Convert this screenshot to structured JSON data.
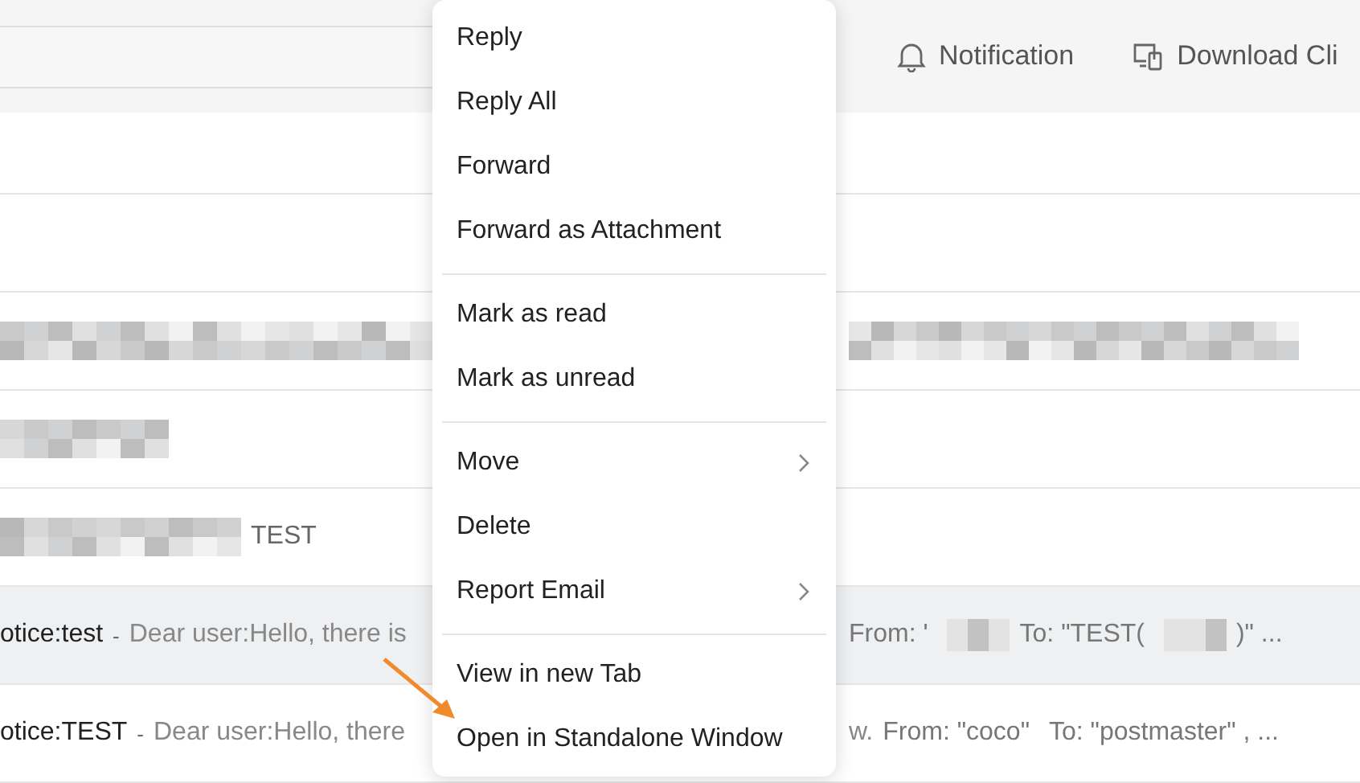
{
  "header": {
    "actions": [
      {
        "label": "Notification"
      },
      {
        "label": "Download Cli"
      }
    ]
  },
  "rows": [
    {
      "kind": "masked",
      "selected": false
    },
    {
      "kind": "masked",
      "selected": false
    },
    {
      "kind": "masked",
      "selected": false,
      "subject": "TEST"
    },
    {
      "kind": "mail",
      "selected": true,
      "subject": "otice:test",
      "dash": "-",
      "preview": "Dear user:Hello, there is",
      "from": "From: '",
      "to": "To: \"TEST(",
      "to_end": ")\" ..."
    },
    {
      "kind": "mail",
      "selected": false,
      "subject": "otice:TEST",
      "dash": "-",
      "preview": "Dear user:Hello, there",
      "tail": "w.",
      "from": "From: \"coco\"",
      "to": "To: \"postmaster\" , ..."
    }
  ],
  "menu": {
    "groups": [
      [
        {
          "label": "Reply",
          "submenu": false
        },
        {
          "label": "Reply All",
          "submenu": false
        },
        {
          "label": "Forward",
          "submenu": false
        },
        {
          "label": "Forward as Attachment",
          "submenu": false
        }
      ],
      [
        {
          "label": "Mark as read",
          "submenu": false
        },
        {
          "label": "Mark as unread",
          "submenu": false
        }
      ],
      [
        {
          "label": "Move",
          "submenu": true
        },
        {
          "label": "Delete",
          "submenu": false
        },
        {
          "label": "Report Email",
          "submenu": true
        }
      ],
      [
        {
          "label": "View in new Tab",
          "submenu": false
        },
        {
          "label": "Open in Standalone Window",
          "submenu": false
        }
      ]
    ]
  }
}
